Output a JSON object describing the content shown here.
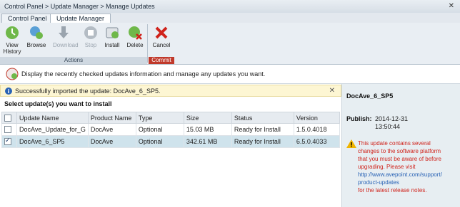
{
  "titlebar": {
    "breadcrumb": "Control Panel > Update Manager > Manage Updates",
    "close": "✕"
  },
  "tabs": [
    {
      "label": "Control Panel"
    },
    {
      "label": "Update Manager"
    }
  ],
  "ribbon": {
    "actions_group": "Actions",
    "commit_group": "Commit",
    "buttons": {
      "view_history": "View History",
      "browse": "Browse",
      "download": "Download",
      "stop": "Stop",
      "install": "Install",
      "delete": "Delete",
      "cancel": "Cancel"
    }
  },
  "info_text": "Display the recently checked updates information and manage any updates you want.",
  "notice": {
    "text": "Successfully imported the update: DocAve_6_SP5.",
    "close": "✕"
  },
  "heading": "Select update(s) you want to install",
  "table": {
    "columns": [
      "Update Name",
      "Product Name",
      "Type",
      "Size",
      "Status",
      "Version"
    ],
    "rows": [
      {
        "name": "DocAve_Update_for_G",
        "product": "DocAve",
        "type": "Optional",
        "size": "15.03 MB",
        "status": "Ready for Install",
        "version": "1.5.0.4018",
        "checked": false
      },
      {
        "name": "DocAve_6_SP5",
        "product": "DocAve",
        "type": "Optional",
        "size": "342.61 MB",
        "status": "Ready for Install",
        "version": "6.5.0.4033",
        "checked": true
      }
    ]
  },
  "details": {
    "name": "DocAve_6_SP5",
    "publish_label": "Publish:",
    "publish_date": "2014-12-31",
    "publish_time": "13:50:44",
    "warning_lines": [
      "This update contains several",
      "changes to the software platform",
      "that you must be aware of before",
      "upgrading. Please visit"
    ],
    "link_lines": [
      "http://www.avepoint.com/support/",
      "product-updates"
    ],
    "warning_tail": "for the latest release notes."
  },
  "colors": {
    "accent_red": "#d0231b",
    "link": "#2a63b5",
    "selected_row": "#cfe3ec"
  }
}
